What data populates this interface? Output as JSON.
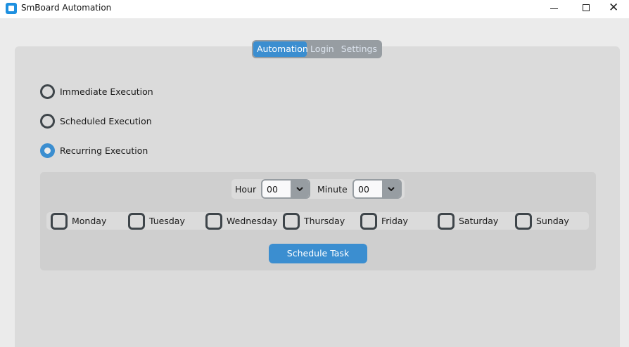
{
  "window": {
    "title": "SmBoard Automation",
    "controls": [
      "minimize-icon",
      "maximize-icon",
      "close-icon"
    ],
    "close_glyph": "✕"
  },
  "tabs": [
    {
      "label": "Automation",
      "active": true
    },
    {
      "label": "Login",
      "active": false
    },
    {
      "label": "Settings",
      "active": false
    }
  ],
  "execution_modes": [
    {
      "label": "Immediate Execution",
      "selected": false
    },
    {
      "label": "Scheduled Execution",
      "selected": false
    },
    {
      "label": "Recurring Execution",
      "selected": true
    }
  ],
  "schedule": {
    "hour_label": "Hour",
    "hour_value": "00",
    "minute_label": "Minute",
    "minute_value": "00",
    "days": [
      {
        "label": "Monday",
        "checked": false
      },
      {
        "label": "Tuesday",
        "checked": false
      },
      {
        "label": "Wednesday",
        "checked": false
      },
      {
        "label": "Thursday",
        "checked": false
      },
      {
        "label": "Friday",
        "checked": false
      },
      {
        "label": "Saturday",
        "checked": false
      },
      {
        "label": "Sunday",
        "checked": false
      }
    ],
    "button_label": "Schedule Task"
  },
  "colors": {
    "accent": "#3b8ed0",
    "panel": "#dbdbdb",
    "inner_panel": "#cfcfcf",
    "segmented_bg": "#979da2"
  }
}
